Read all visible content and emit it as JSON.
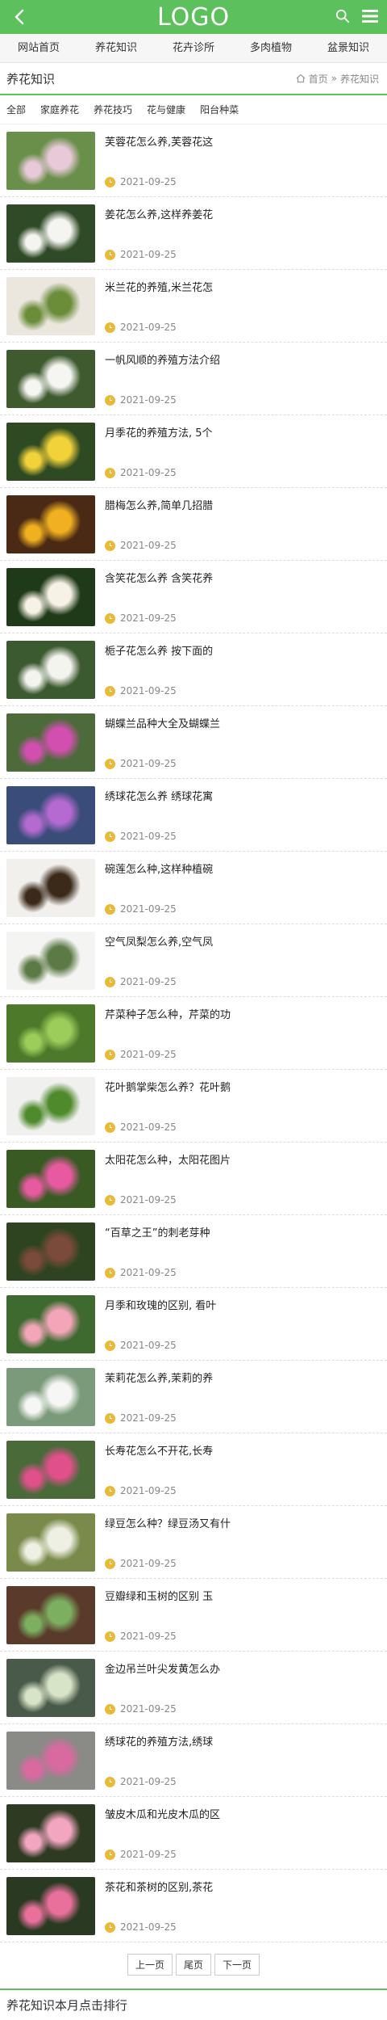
{
  "header": {
    "logo": "LOGO"
  },
  "nav": [
    "网站首页",
    "养花知识",
    "花卉诊所",
    "多肉植物",
    "盆景知识"
  ],
  "section": {
    "title": "养花知识",
    "crumb_home": "首页",
    "crumb_sep": "»",
    "crumb_current": "养花知识"
  },
  "subtabs": [
    "全部",
    "家庭养花",
    "养花技巧",
    "花与健康",
    "阳台种菜"
  ],
  "items": [
    {
      "title": "芙蓉花怎么养,芙蓉花这",
      "date": "2021-09-25",
      "c1": "#6a8f4a",
      "c2": "#e8c9d8"
    },
    {
      "title": "姜花怎么养,这样养姜花",
      "date": "2021-09-25",
      "c1": "#2f4a26",
      "c2": "#f4f4f0"
    },
    {
      "title": "米兰花的养殖,米兰花怎",
      "date": "2021-09-25",
      "c1": "#ebe6de",
      "c2": "#6b8d3a"
    },
    {
      "title": "一帆风顺的养殖方法介绍",
      "date": "2021-09-25",
      "c1": "#3e5a2e",
      "c2": "#f5f5f2"
    },
    {
      "title": "月季花的养殖方法, 5个",
      "date": "2021-09-25",
      "c1": "#2e4a22",
      "c2": "#f2d23a"
    },
    {
      "title": "腊梅怎么养,简单几招腊",
      "date": "2021-09-25",
      "c1": "#4a2a14",
      "c2": "#f0b020"
    },
    {
      "title": "含笑花怎么养 含笑花养",
      "date": "2021-09-25",
      "c1": "#1f3a18",
      "c2": "#f7f2e6"
    },
    {
      "title": "栀子花怎么养 按下面的",
      "date": "2021-09-25",
      "c1": "#3c5a30",
      "c2": "#f4f4ef"
    },
    {
      "title": "蝴蝶兰品种大全及蝴蝶兰",
      "date": "2021-09-25",
      "c1": "#4c6a3a",
      "c2": "#d24fb0"
    },
    {
      "title": "绣球花怎么养 绣球花寓",
      "date": "2021-09-25",
      "c1": "#3a4d7a",
      "c2": "#b46ad0"
    },
    {
      "title": "碗莲怎么种,这样种植碗",
      "date": "2021-09-25",
      "c1": "#f2f0ec",
      "c2": "#3b2a1a"
    },
    {
      "title": "空气凤梨怎么养,空气凤",
      "date": "2021-09-25",
      "c1": "#f4f4f2",
      "c2": "#5b7a45"
    },
    {
      "title": "芹菜种子怎么种，芹菜的功",
      "date": "2021-09-25",
      "c1": "#4d7a2a",
      "c2": "#9ccc5a"
    },
    {
      "title": "花叶鹅掌柴怎么养？花叶鹅",
      "date": "2021-09-25",
      "c1": "#f0f0ee",
      "c2": "#4f8a2c"
    },
    {
      "title": "太阳花怎么种，太阳花图片",
      "date": "2021-09-25",
      "c1": "#3a5a24",
      "c2": "#e85aa0"
    },
    {
      "title": "“百草之王”的刺老芽种",
      "date": "2021-09-25",
      "c1": "#2e4420",
      "c2": "#7a4a3a"
    },
    {
      "title": "月季和玫瑰的区别, 看叶",
      "date": "2021-09-25",
      "c1": "#3e6a30",
      "c2": "#f2a6b8"
    },
    {
      "title": "茉莉花怎么养,茉莉的养",
      "date": "2021-09-25",
      "c1": "#7a9a7a",
      "c2": "#f6f6f4"
    },
    {
      "title": "长寿花怎么不开花,长寿",
      "date": "2021-09-25",
      "c1": "#4a6a3a",
      "c2": "#e0508a"
    },
    {
      "title": "绿豆怎么种？绿豆汤又有什",
      "date": "2021-09-25",
      "c1": "#7a8a4a",
      "c2": "#eef0e4"
    },
    {
      "title": "豆瓣绿和玉树的区别 玉",
      "date": "2021-09-25",
      "c1": "#5a3a2a",
      "c2": "#7cb060"
    },
    {
      "title": "金边吊兰叶尖发黄怎么办",
      "date": "2021-09-25",
      "c1": "#4a5a4a",
      "c2": "#d8e4c8"
    },
    {
      "title": "绣球花的养殖方法,绣球",
      "date": "2021-09-25",
      "c1": "#8a8a86",
      "c2": "#d86aa0"
    },
    {
      "title": "皱皮木瓜和光皮木瓜的区",
      "date": "2021-09-25",
      "c1": "#2e3a22",
      "c2": "#f2a6c0"
    },
    {
      "title": "茶花和茶树的区别,茶花",
      "date": "2021-09-25",
      "c1": "#2a3a22",
      "c2": "#e8709a"
    }
  ],
  "pager": {
    "prev": "上一页",
    "current": "尾页",
    "next": "下一页"
  },
  "bottom": {
    "title": "养花知识本月点击排行"
  }
}
